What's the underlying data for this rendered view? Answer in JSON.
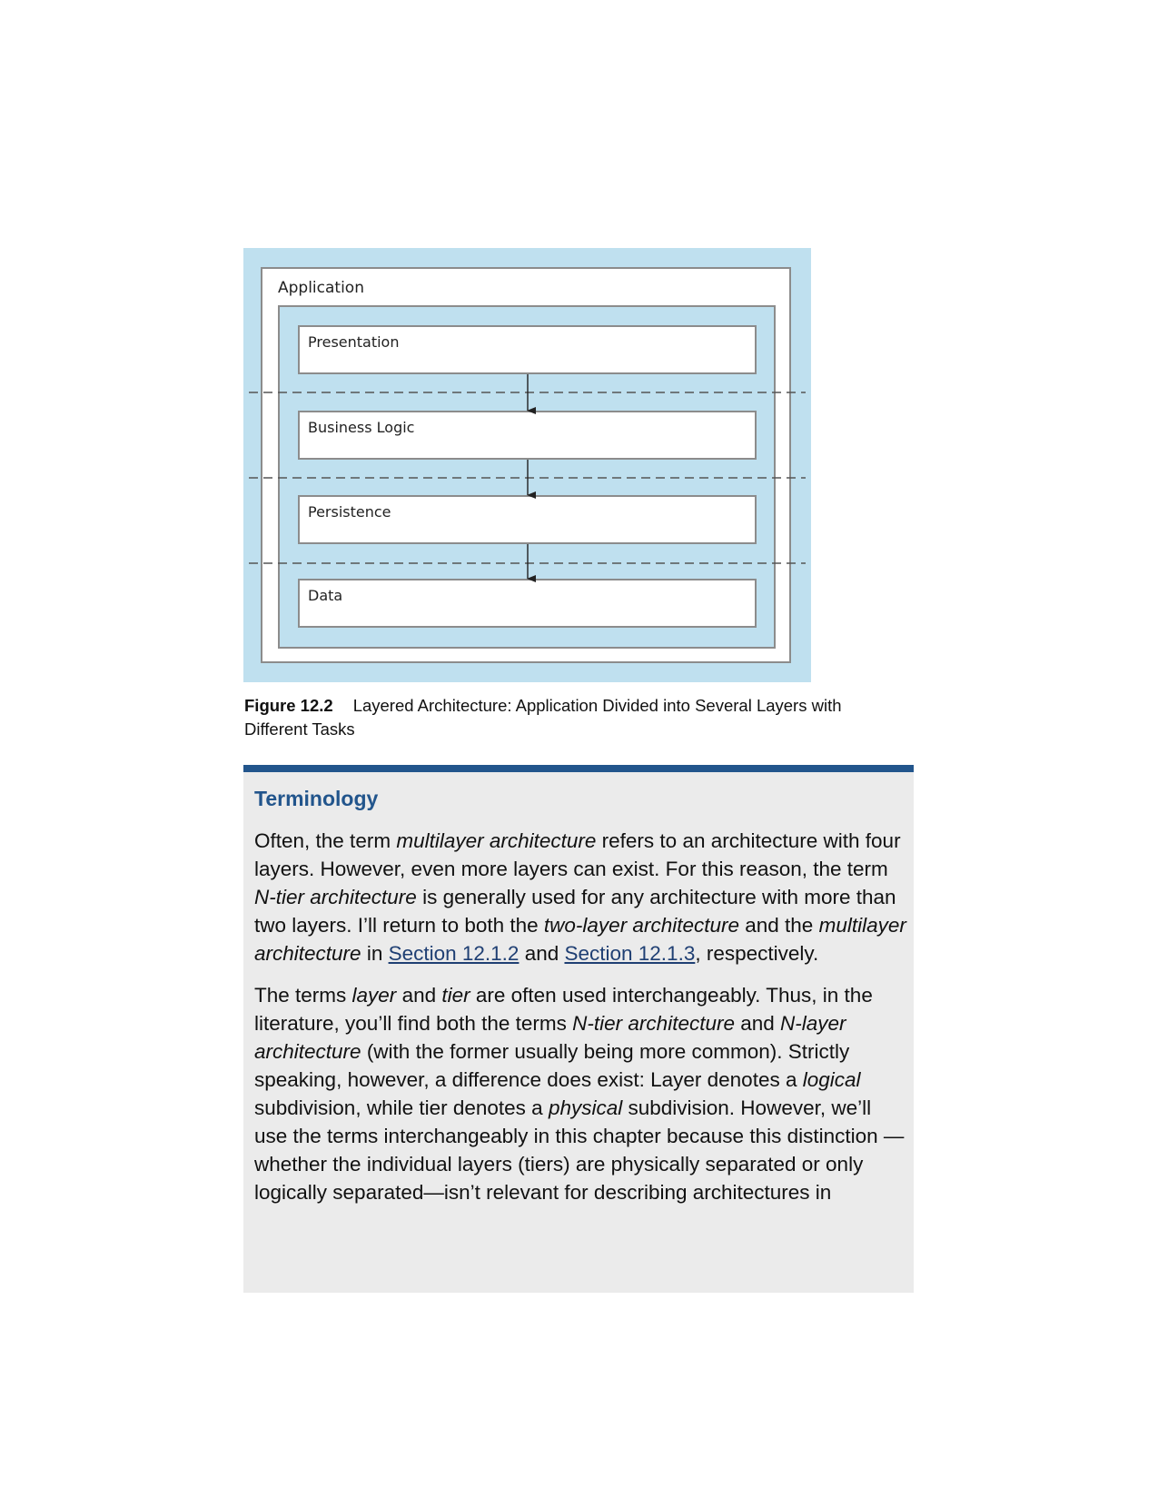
{
  "figure": {
    "app_label": "Application",
    "layers": [
      "Presentation",
      "Business Logic",
      "Persistence",
      "Data"
    ]
  },
  "caption": {
    "number": "Figure 12.2",
    "text": "Layered Architecture: Application Divided into Several Layers with Different Tasks"
  },
  "terminology": {
    "title": "Terminology",
    "p1": {
      "t1": "Often, the term ",
      "i1": "multilayer architecture",
      "t2": " refers to an architecture with four layers. However, even more layers can exist. For this reason, the term ",
      "i2": "N-tier architecture",
      "t3": " is generally used for any architecture with more than two layers. I’ll return to both the ",
      "i3": "two-layer architecture",
      "t4": " and the ",
      "i4": "multilayer architecture",
      "t5": " in ",
      "link1": "Section 12.1.2",
      "t6": " and ",
      "link2": "Section 12.1.3",
      "t7": ", respectively."
    },
    "p2": {
      "t1": "The terms ",
      "i1": "layer",
      "t2": " and ",
      "i2": "tier",
      "t3": " are often used interchangeably. Thus, in the literature, you’ll find both the terms ",
      "i3": "N-tier architecture",
      "t4": " and ",
      "i4": "N-layer architecture",
      "t5": " (with the former usually being more common). Strictly speaking, however, a difference does exist: Layer denotes a ",
      "i5": "logical",
      "t6": " subdivision, while tier denotes a ",
      "i6": "physical",
      "t7": " subdivision. However, we’ll use the terms interchangeably in this chapter because this distinction —whether the individual layers (tiers) are physically separated or only logically separated—isn’t relevant for describing architectures in"
    }
  }
}
